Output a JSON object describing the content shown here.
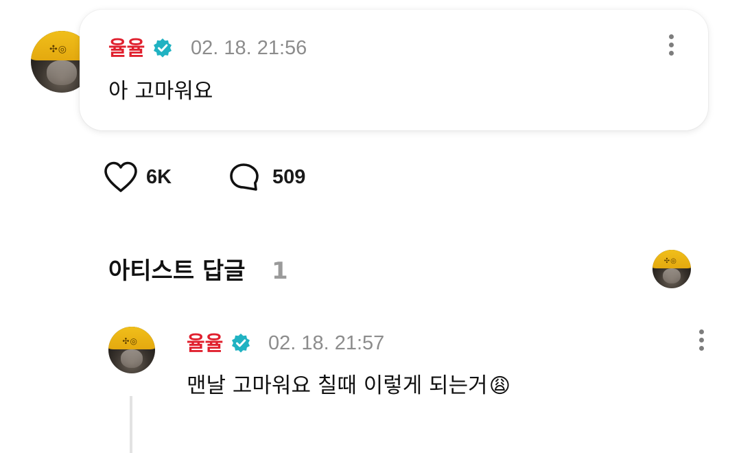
{
  "post": {
    "author": "율율",
    "timestamp": "02. 18. 21:56",
    "text": "아 고마워요",
    "verified_color": "#20b2c2",
    "name_color": "#e0202e"
  },
  "stats": {
    "likes": "6K",
    "comments": "509"
  },
  "section": {
    "title": "아티스트 답글",
    "count": "1"
  },
  "reply": {
    "author": "율율",
    "timestamp": "02. 18. 21:57",
    "text": "맨날 고마워요 칠때 이렇게 되는거",
    "emoji": "😩"
  },
  "icons": {
    "more": "more-vertical-icon",
    "like": "heart-icon",
    "comment": "comment-bubble-icon",
    "verified": "verified-badge-icon"
  }
}
